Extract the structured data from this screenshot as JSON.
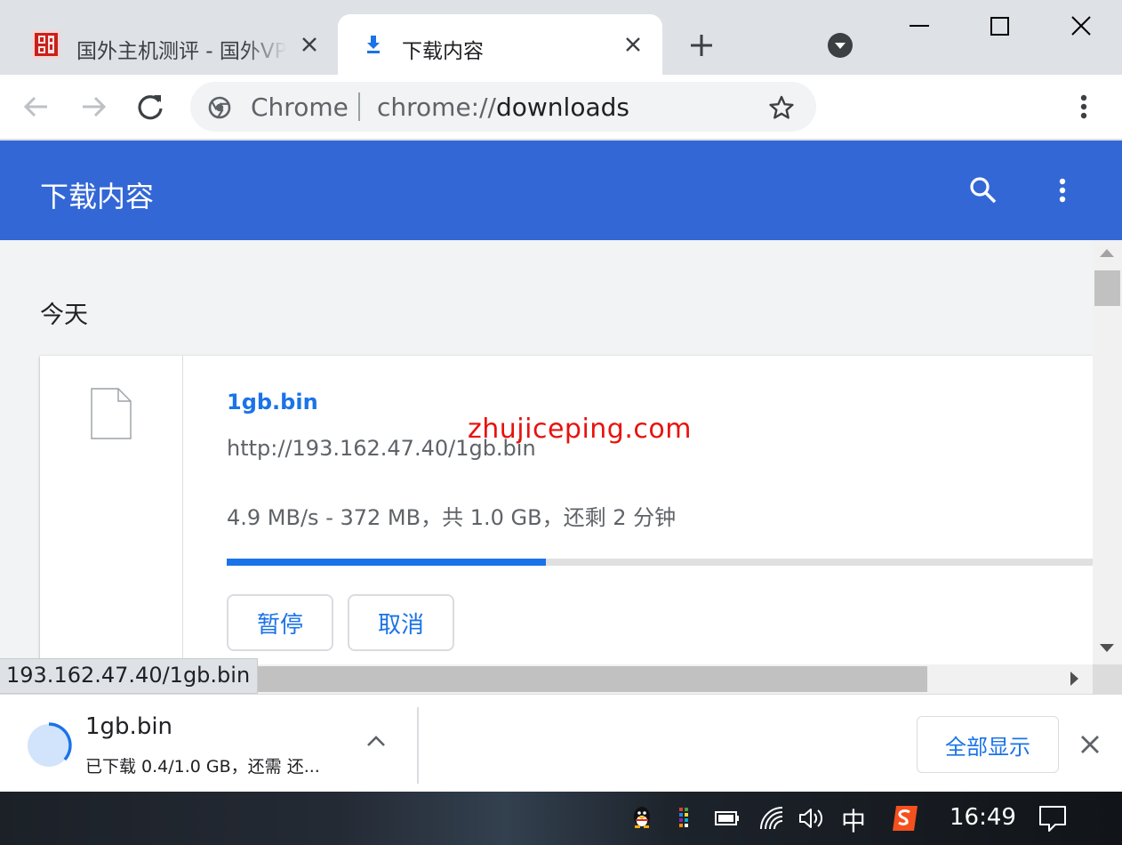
{
  "tabs": [
    {
      "title": "国外主机测评 - 国外VPS",
      "active": false,
      "favicon": "site-logo-icon"
    },
    {
      "title": "下载内容",
      "active": true,
      "favicon": "download-icon"
    }
  ],
  "omnibox": {
    "chip": "Chrome",
    "url_scheme": "chrome://",
    "url_host": "downloads"
  },
  "page": {
    "title": "下载内容",
    "section": "今天",
    "watermark": "zhujiceping.com"
  },
  "download": {
    "name": "1gb.bin",
    "url": "http://193.162.47.40/1gb.bin",
    "status": "4.9 MB/s - 372 MB，共 1.0 GB，还剩 2 分钟",
    "progress": 0.366,
    "pause_label": "暂停",
    "cancel_label": "取消"
  },
  "status_bubble": "193.162.47.40/1gb.bin",
  "shelf": {
    "name": "1gb.bin",
    "status": "已下载 0.4/1.0 GB，还需 还...",
    "show_all": "全部显示"
  },
  "taskbar": {
    "ime": "中",
    "clock": "16:49"
  },
  "colors": {
    "header": "#3367d6",
    "accent": "#1a73e8",
    "watermark": "#e8120d"
  }
}
